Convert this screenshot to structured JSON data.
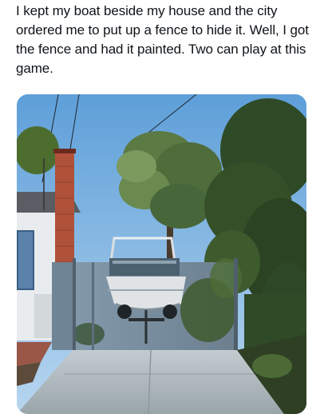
{
  "post": {
    "text": "I kept my boat beside my house and the city ordered me to put up a fence to hide it. Well, I got the fence and had it painted. Two can play at this game."
  },
  "media": {
    "type": "photo",
    "colors": {
      "sky": "#7fb6e6",
      "house": "#e9ecef",
      "brick": "#b0523a",
      "fence": "#7a8fa0",
      "trees": "#3f5a2e",
      "concrete": "#b9c2c6"
    }
  }
}
